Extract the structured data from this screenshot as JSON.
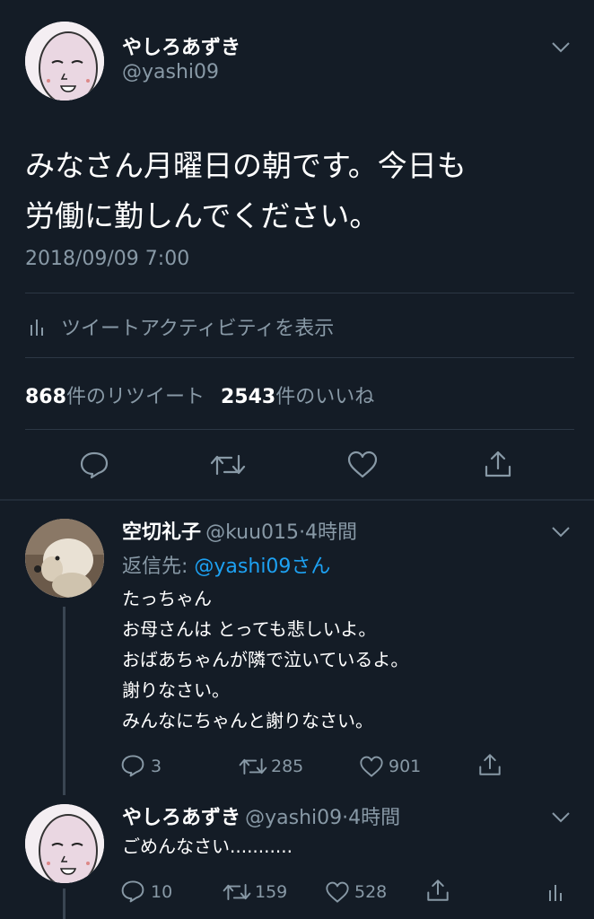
{
  "main_tweet": {
    "author_name": "やしろあずき",
    "author_handle": "@yashi09",
    "text_line1": "みなさん月曜日の朝です。今日も",
    "text_line2": "労働に勤しんでください。",
    "timestamp": "2018/09/09 7:00",
    "activity_label": "ツイートアクティビティを表示",
    "retweet_count": "868",
    "retweet_label": "件のリツイート",
    "like_count": "2543",
    "like_label": "件のいいね"
  },
  "replies": [
    {
      "author_name": "空切礼子",
      "author_handle": "@kuu015",
      "time": "·4時間",
      "reply_to_prefix": "返信先: ",
      "reply_to_handle": "@yashi09さん",
      "lines": [
        "たっちゃん",
        "お母さんは とっても悲しいよ。",
        "おばあちゃんが隣で泣いているよ。",
        "謝りなさい。",
        "みんなにちゃんと謝りなさい。"
      ],
      "reply_count": "3",
      "retweet_count": "285",
      "like_count": "901"
    },
    {
      "author_name": "やしろあずき",
      "author_handle": "@yashi09",
      "time": "·4時間",
      "lines": [
        "ごめんなさい..........."
      ],
      "reply_count": "10",
      "retweet_count": "159",
      "like_count": "528"
    }
  ],
  "colors": {
    "background": "#141c26",
    "muted": "#8899a6",
    "link": "#1da1f2",
    "divider": "#2c3744"
  },
  "icons": [
    "chevron-down-icon",
    "bar-chart-icon",
    "reply-icon",
    "retweet-icon",
    "like-icon",
    "share-icon"
  ]
}
